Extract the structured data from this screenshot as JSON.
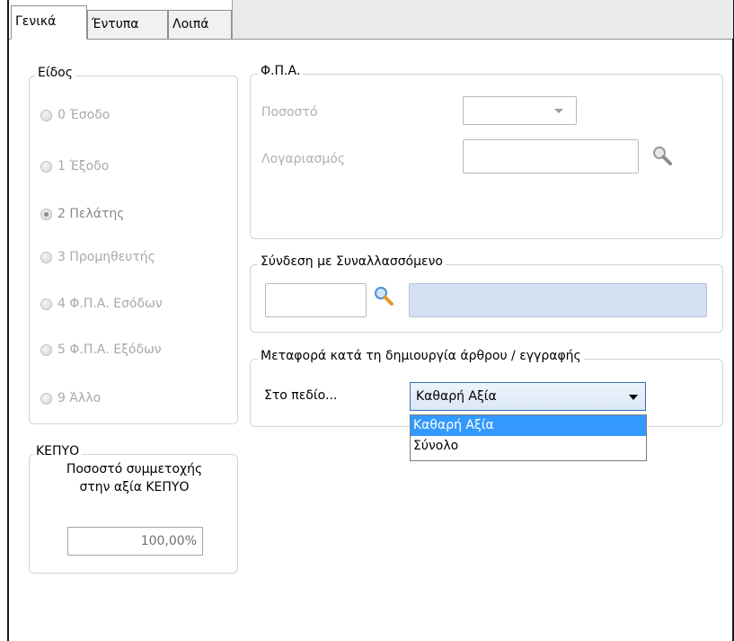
{
  "tabs": [
    {
      "label": "Γενικά",
      "active": true
    },
    {
      "label": "Έντυπα",
      "active": false
    },
    {
      "label": "Λοιπά",
      "active": false
    }
  ],
  "kind_group": {
    "title": "Είδος",
    "options": [
      {
        "label": "0 Έσοδο",
        "checked": false
      },
      {
        "label": "1 Έξοδο",
        "checked": false
      },
      {
        "label": "2 Πελάτης",
        "checked": true
      },
      {
        "label": "3 Προμηθευτής",
        "checked": false
      },
      {
        "label": "4 Φ.Π.Α. Εσόδων",
        "checked": false
      },
      {
        "label": "5 Φ.Π.Α. Εξόδων",
        "checked": false
      },
      {
        "label": "9 Άλλο",
        "checked": false
      }
    ]
  },
  "kepyo_group": {
    "title": "ΚΕΠΥΟ",
    "desc_line1": "Ποσοστό συμμετοχής",
    "desc_line2": "στην αξία ΚΕΠΥΟ",
    "value": "100,00%"
  },
  "vat_group": {
    "title": "Φ.Π.Α.",
    "rate_label": "Ποσοστό",
    "account_label": "Λογαριασμός",
    "rate_value": "",
    "account_value": ""
  },
  "link_group": {
    "title": "Σύνδεση με Συναλλασσόμενο",
    "code_value": "",
    "name_value": ""
  },
  "transfer_group": {
    "title": "Μεταφορά κατά τη δημιουργία άρθρου / εγγραφής",
    "field_label": "Στο πεδίο...",
    "selected": "Καθαρή Αξία",
    "options": [
      "Καθαρή Αξία",
      "Σύνολο"
    ]
  },
  "icons": [
    "magnifier-icon",
    "chevron-down-icon"
  ],
  "colors": {
    "highlight": "#3399ff",
    "link_name_field": "#d4dff2",
    "group_border": "#cfd4da"
  }
}
